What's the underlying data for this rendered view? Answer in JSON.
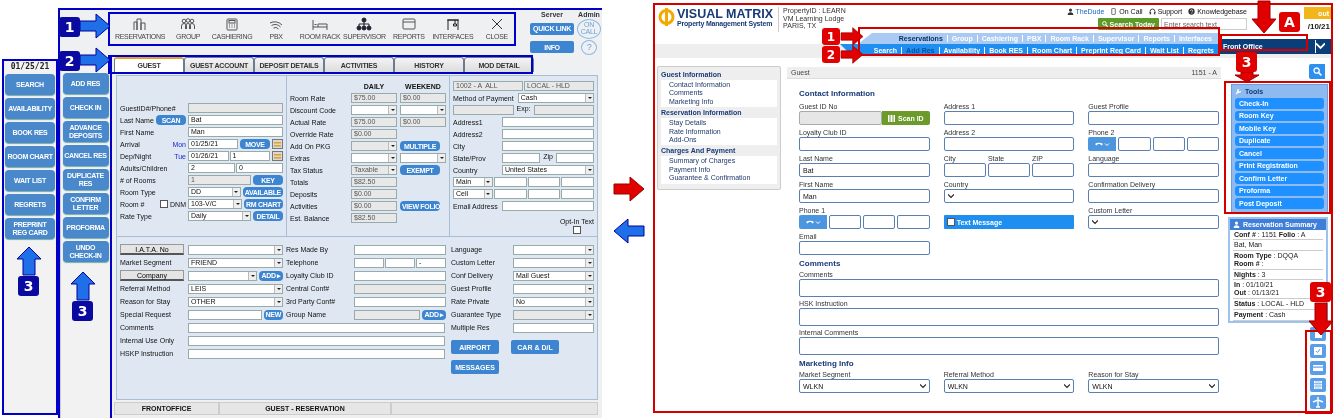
{
  "legacy": {
    "server_label": "Server",
    "admin_label": "Admin",
    "toolbar": [
      {
        "label": "RESERVATIONS",
        "kind": "buildings"
      },
      {
        "label": "GROUP",
        "kind": "people"
      },
      {
        "label": "CASHIERING",
        "kind": "register"
      },
      {
        "label": "PBX",
        "kind": "signal"
      },
      {
        "label": "ROOM RACK",
        "kind": "bed"
      },
      {
        "label": "SUPERVISOR",
        "kind": "hierarchy"
      },
      {
        "label": "REPORTS",
        "kind": "window"
      },
      {
        "label": "INTERFACES",
        "kind": "gantry"
      },
      {
        "label": "CLOSE",
        "kind": "close"
      }
    ],
    "quick_buttons": [
      "QUICK LINK",
      "INFO"
    ],
    "on_call": "ON CALL",
    "help": "?",
    "tabs": [
      {
        "label": "GUEST",
        "selected": true
      },
      {
        "label": "GUEST ACCOUNT",
        "selected": false
      },
      {
        "label": "DEPOSIT DETAILS",
        "selected": false
      },
      {
        "label": "ACTIVITIES",
        "selected": false
      },
      {
        "label": "HISTORY",
        "selected": false
      },
      {
        "label": "MOD DETAIL",
        "selected": false
      }
    ],
    "date": "01/25/21",
    "nav_buttons": [
      "SEARCH",
      "AVAILABILITY",
      "BOOK RES",
      "ROOM CHART",
      "WAIT LIST",
      "REGRETS",
      "PREPRINT REG CARD"
    ],
    "action_buttons": [
      "ADD RES",
      "CHECK IN",
      "ADVANCE DEPOSITS",
      "CANCEL RES",
      "DUPLICATE RES",
      "CONFIRM LETTER",
      "PROFORMA",
      "UNDO CHECK-IN"
    ],
    "guest": [
      {
        "label": "GuestID#/Phone#",
        "fields": [
          {
            "kind": "readonly"
          }
        ]
      },
      {
        "label": "Last Name",
        "label_button": "SCAN",
        "fields": [
          {
            "kind": "text",
            "value": "Bat"
          }
        ]
      },
      {
        "label": "First Name",
        "fields": [
          {
            "kind": "text",
            "value": "Man"
          }
        ]
      },
      {
        "label": "Arrival",
        "day": "Mon",
        "fields": [
          {
            "kind": "text",
            "value": "01/25/21"
          }
        ],
        "buttons": [
          "MOVE"
        ],
        "calendar": true
      },
      {
        "label": "Dep/Night",
        "day": "Tue",
        "fields": [
          {
            "kind": "text",
            "value": "01/26/21"
          },
          {
            "kind": "text",
            "value": "1"
          }
        ],
        "calendar": true
      },
      {
        "label": "Adults/Children",
        "fields": [
          {
            "kind": "text",
            "value": "2"
          },
          {
            "kind": "text",
            "value": "0"
          }
        ]
      },
      {
        "label": "# of Rooms",
        "fields": [
          {
            "kind": "readonly",
            "value": "1"
          }
        ],
        "buttons": [
          "KEY"
        ]
      },
      {
        "label": "Room Type",
        "fields": [
          {
            "kind": "select",
            "value": "DD"
          }
        ],
        "buttons": [
          "AVAILABLE"
        ]
      },
      {
        "label": "Room #",
        "checkbox": {
          "label": "DNM",
          "checked": false
        },
        "fields": [
          {
            "kind": "select",
            "value": "103-V/C"
          }
        ],
        "buttons": [
          "RM CHART"
        ]
      },
      {
        "label": "Rate Type",
        "fields": [
          {
            "kind": "select",
            "value": "Daily"
          }
        ],
        "buttons": [
          "DETAIL"
        ]
      }
    ],
    "rates": {
      "headers": [
        "DAILY",
        "WEEKEND"
      ],
      "rows": [
        {
          "label": "Room Rate",
          "fields": [
            {
              "kind": "readonly",
              "value": "$75.00"
            },
            {
              "kind": "readonly",
              "value": "$0.00"
            }
          ]
        },
        {
          "label": "Discount Code",
          "fields": [
            {
              "kind": "select"
            },
            {
              "kind": "select"
            }
          ]
        },
        {
          "label": "Actual Rate",
          "fields": [
            {
              "kind": "readonly",
              "value": "$75.00"
            },
            {
              "kind": "readonly",
              "value": "$0.00"
            }
          ]
        },
        {
          "label": "Override Rate",
          "fields": [
            {
              "kind": "readonly",
              "value": "$0.00"
            }
          ]
        },
        {
          "label": "Add On PKG",
          "fields": [
            {
              "kind": "select_disabled"
            }
          ],
          "buttons": [
            "MULTIPLE"
          ]
        },
        {
          "label": "Extras",
          "fields": [
            {
              "kind": "select"
            },
            {
              "kind": "select"
            }
          ]
        },
        {
          "label": "Tax Status",
          "fields": [
            {
              "kind": "select_disabled",
              "value": "Taxable"
            }
          ],
          "buttons": [
            "EXEMPT"
          ]
        },
        {
          "label": "Totals",
          "fields": [
            {
              "kind": "readonly",
              "value": "$82.50"
            }
          ]
        },
        {
          "label": "Deposits",
          "fields": [
            {
              "kind": "readonly",
              "value": "$0.00"
            }
          ]
        },
        {
          "label": "Activities",
          "fields": [
            {
              "kind": "readonly",
              "value": "$0.00"
            }
          ],
          "buttons": [
            "VIEW FOLIO"
          ]
        },
        {
          "label": "Est. Balance",
          "fields": [
            {
              "kind": "readonly",
              "value": "$82.50"
            }
          ]
        }
      ]
    },
    "address": {
      "rows": [
        {
          "fields": [
            {
              "kind": "readonly",
              "value": "1002 - A  ALL"
            },
            {
              "kind": "readonly",
              "value": "LOCAL - HLD"
            }
          ]
        },
        {
          "label": "Method of Payment",
          "fields": [
            {
              "kind": "select",
              "value": "Cash"
            }
          ]
        },
        {
          "fields": [
            {
              "kind": "readonly"
            },
            {
              "kind": "readonly",
              "label": "Exp:"
            }
          ]
        },
        {
          "label": "Address1",
          "fields": [
            {
              "kind": "text"
            }
          ]
        },
        {
          "label": "Address2",
          "fields": [
            {
              "kind": "text"
            }
          ]
        },
        {
          "label": "City",
          "fields": [
            {
              "kind": "text"
            }
          ]
        },
        {
          "label": "State/Prov",
          "fields": [
            {
              "kind": "text"
            },
            {
              "kind": "text",
              "label": "Zip"
            }
          ]
        },
        {
          "label": "Country",
          "fields": [
            {
              "kind": "select",
              "value": "United States"
            }
          ]
        },
        {
          "fields": [
            {
              "kind": "select",
              "value": "Main"
            },
            {
              "kind": "text"
            },
            {
              "kind": "text"
            },
            {
              "kind": "text"
            }
          ]
        },
        {
          "fields": [
            {
              "kind": "select",
              "value": "Cell"
            },
            {
              "kind": "text"
            },
            {
              "kind": "text"
            },
            {
              "kind": "text"
            }
          ]
        },
        {
          "label": "Email Address",
          "fields": [
            {
              "kind": "text"
            }
          ]
        }
      ],
      "opt_in": {
        "label": "Opt-In Text",
        "checked": false
      }
    },
    "details": [
      {
        "label": "I.A.T.A. No",
        "label_is_button": true,
        "fields": [
          {
            "kind": "select"
          }
        ]
      },
      {
        "label": "Market Segment",
        "fields": [
          {
            "kind": "select",
            "value": "FRIEND"
          }
        ]
      },
      {
        "label": "Company",
        "label_is_button": true,
        "fields": [
          {
            "kind": "select"
          }
        ],
        "buttons": [
          "ADD ▸"
        ]
      },
      {
        "label": "Referral Method",
        "fields": [
          {
            "kind": "select",
            "value": "LEIS"
          }
        ]
      },
      {
        "label": "Reason for Stay",
        "fields": [
          {
            "kind": "select",
            "value": "OTHER"
          }
        ]
      },
      {
        "label": "Special Request",
        "fields": [
          {
            "kind": "text"
          }
        ],
        "buttons": [
          "NEW"
        ]
      }
    ],
    "contact": [
      {
        "label": "Res Made By",
        "fields": [
          {
            "kind": "text"
          }
        ]
      },
      {
        "label": "Telephone",
        "fields": [
          {
            "kind": "text"
          },
          {
            "kind": "text"
          },
          {
            "kind": "text",
            "value": "-"
          }
        ]
      },
      {
        "label": "Loyalty Club ID",
        "fields": [
          {
            "kind": "text"
          }
        ]
      },
      {
        "label": "Central Conf#",
        "fields": [
          {
            "kind": "readonly"
          }
        ]
      },
      {
        "label": "3rd Party Conf#",
        "fields": [
          {
            "kind": "text"
          }
        ]
      },
      {
        "label": "Group Name",
        "fields": [
          {
            "kind": "readonly"
          }
        ],
        "buttons": [
          "ADD ▸"
        ]
      }
    ],
    "notes": [
      {
        "label": "Comments",
        "fields": [
          {
            "kind": "text"
          }
        ]
      },
      {
        "label": "Internal Use Only",
        "fields": [
          {
            "kind": "text"
          }
        ]
      },
      {
        "label": "HSKP Instruction",
        "fields": [
          {
            "kind": "text"
          }
        ]
      }
    ],
    "preferences": [
      {
        "label": "Language",
        "fields": [
          {
            "kind": "select"
          }
        ]
      },
      {
        "label": "Custom Letter",
        "fields": [
          {
            "kind": "select"
          }
        ]
      },
      {
        "label": "Conf Delivery",
        "fields": [
          {
            "kind": "select",
            "value": "Mail Guest"
          }
        ]
      },
      {
        "label": "Guest Profile",
        "fields": [
          {
            "kind": "select"
          }
        ]
      },
      {
        "label": "Rate Private",
        "fields": [
          {
            "kind": "select",
            "value": "No"
          }
        ]
      },
      {
        "label": "Guarantee Type",
        "fields": [
          {
            "kind": "select_disabled"
          }
        ]
      },
      {
        "label": "Multiple Res",
        "fields": [
          {
            "kind": "text"
          }
        ]
      }
    ],
    "extra_buttons": [
      "AIRPORT",
      "CAR & D/L",
      "MESSAGES"
    ],
    "status_bar": [
      "FRONTOFFICE",
      "GUEST - RESERVATION"
    ]
  },
  "web": {
    "logo": {
      "name": "VISUAL MATRIX",
      "tagline": "Property Management System"
    },
    "property": [
      "PropertyID : LEARN",
      "VM Learning Lodge",
      "PARIS, TX"
    ],
    "user_links": [
      {
        "label": "TheDude",
        "kind": "user"
      },
      {
        "label": "On Call",
        "kind": "phone"
      },
      {
        "label": "Support",
        "kind": "headset"
      },
      {
        "label": "Knowledgebase",
        "kind": "help"
      }
    ],
    "sign_out": "out",
    "search_button": "Search Today",
    "search": {
      "placeholder": "Enter search text"
    },
    "date": "/10/21",
    "menu": [
      {
        "label": "Reservations",
        "selected": true
      },
      {
        "label": "Group",
        "selected": false
      },
      {
        "label": "Cashiering",
        "selected": false
      },
      {
        "label": "PBX",
        "selected": false
      },
      {
        "label": "Room Rack",
        "selected": false
      },
      {
        "label": "Supervisor",
        "selected": false
      },
      {
        "label": "Reports",
        "selected": false
      },
      {
        "label": "Interfaces",
        "selected": false
      }
    ],
    "submenu": [
      {
        "label": "Search",
        "selected": false
      },
      {
        "label": "Add Res",
        "selected": true
      },
      {
        "label": "Availability",
        "selected": false
      },
      {
        "label": "Book RES",
        "selected": false
      },
      {
        "label": "Room Chart",
        "selected": false
      },
      {
        "label": "Preprint Reg Card",
        "selected": false
      },
      {
        "label": "Wait List",
        "selected": false
      },
      {
        "label": "Regrets",
        "selected": false
      }
    ],
    "department": "Front Office",
    "sidebar": [
      {
        "title": "Guest Information",
        "items": [
          "Contact Information",
          "Comments",
          "Marketing Info"
        ]
      },
      {
        "title": "Reservation Information",
        "items": [
          "Stay Details",
          "Rate Information",
          "Add-Ons"
        ]
      },
      {
        "title": "Charges And Payment",
        "items": [
          "Summary of Charges",
          "Payment Info",
          "Guarantee & Confirmation"
        ]
      }
    ],
    "form_header": {
      "title": "Guest",
      "reference": "1151 - A"
    },
    "contact_title": "Contact Information",
    "contact": [
      {
        "label": "Guest ID No",
        "kind": "scan",
        "button": "Scan ID"
      },
      {
        "label": "Address 1",
        "kind": "text"
      },
      {
        "label": "Guest Profile",
        "kind": "text"
      },
      {
        "label": "Loyalty Club ID",
        "kind": "text"
      },
      {
        "label": "Address 2",
        "kind": "text"
      },
      {
        "label": "Phone 2",
        "kind": "phone"
      },
      {
        "label": "Last Name",
        "kind": "text",
        "value": "Bat"
      },
      {
        "kind": "multi",
        "parts": [
          "City",
          "State",
          "ZIP"
        ]
      },
      {
        "label": "Language",
        "kind": "text"
      },
      {
        "label": "First Name",
        "kind": "text",
        "value": "Man"
      },
      {
        "label": "Country",
        "kind": "select"
      },
      {
        "label": "Confirmation Delivery",
        "kind": "text"
      },
      {
        "label": "Phone 1",
        "kind": "phone"
      },
      {
        "label": "Text Message",
        "kind": "toggle",
        "checked": false
      },
      {
        "label": "Custom Letter",
        "kind": "select"
      },
      {
        "label": "Email",
        "kind": "text"
      }
    ],
    "comments_title": "Comments",
    "comments": [
      "Comments",
      "HSK Instruction",
      "Internal Comments"
    ],
    "marketing_title": "Marketing Info",
    "marketing": [
      {
        "label": "Market Segment",
        "value": "WLKN"
      },
      {
        "label": "Referral Method",
        "value": "WLKN"
      },
      {
        "label": "Reason for Stay",
        "value": "WLKN"
      }
    ],
    "tools": {
      "title": "Tools",
      "buttons": [
        "Check-In",
        "Room Key",
        "Mobile Key",
        "Duplicate",
        "Cancel",
        "Print Registration",
        "Confirm Letter",
        "Proforma",
        "Post Deposit"
      ]
    },
    "summary": {
      "title": "Reservation Summary",
      "groups": [
        [
          "**Conf #** : 1151   **Folio** : A"
        ],
        [
          "Bat, Man"
        ],
        [
          "**Room Type** : DQQA",
          "**Room #** :"
        ],
        [
          "**Nights** : 3"
        ],
        [
          "**In** : 01/10/21",
          "**Out** : 01/13/21"
        ],
        [
          "**Status** : LOCAL - HLD"
        ],
        [
          "**Payment** : Cash"
        ]
      ]
    }
  },
  "annotations": {
    "legacy": [
      "1",
      "2",
      "3",
      "3"
    ],
    "web": [
      "1",
      "2",
      "A",
      "3",
      "3"
    ]
  }
}
